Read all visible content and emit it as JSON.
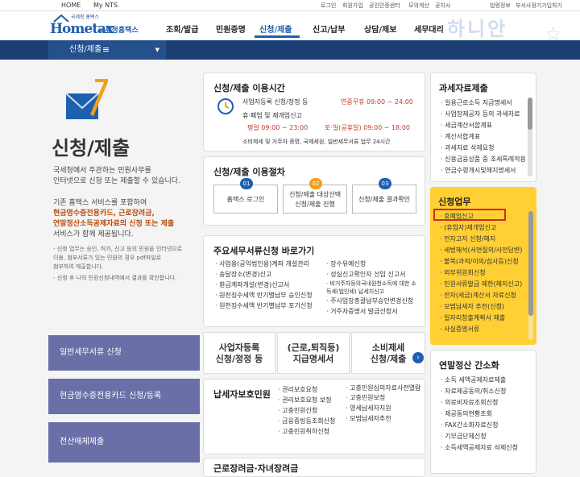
{
  "topbar": {
    "tabs": [
      "HOME",
      "My NTS"
    ],
    "links": [
      "로그인",
      "회원가입",
      "공인인증센터",
      "모의계산",
      "공지사항",
      "법령정보",
      "부서사정기가입하기"
    ]
  },
  "header": {
    "logo_small": "국세청 홈택스",
    "logo_name": "Hometax",
    "logo_kor": "국세청홈택스",
    "menu": [
      "조회/발급",
      "민원증명",
      "신청/제출",
      "신고/납부",
      "상담/제보",
      "세무대리"
    ],
    "watermark": "하니안",
    "watermark_star": "☆"
  },
  "navbar": {
    "selected": "신청/제출"
  },
  "left": {
    "title": "신청/제출",
    "desc1": [
      "국세청에서 주관하는 민원사무를",
      "인터넷으로 신청 또는 제출할 수 있습니다."
    ],
    "desc2_pre": "기존 홈택스 서비스를 포함하여",
    "desc2_hl1": "현금영수증전용카드, 근로장려금,",
    "desc2_hl2": "연말정산소득공제자료의 신청 또는 제출",
    "desc2_post": "서비스가 함께 제공됩니다.",
    "note1": [
      "- 신청 업무는 승인, 허가, 신고 등의 민원을 인터넷으로",
      "  이용, 첨부서류가 있는 민원의 경우 pdf파일로",
      "  첨부하여 제출합니다."
    ],
    "note2": "- 신청 후 나의 민원신청내역에서 결과를 확인합니다.",
    "buttons": [
      "일반세무서류 신청",
      "현금영수증전용카드 신청/등록",
      "전산매체제출"
    ]
  },
  "hours": {
    "title": "신청/제출 이용시간",
    "row1_label": "사업자등록 신청/정정 등",
    "row1_value": "연중무휴 09:00 ~ 24:00",
    "row2_label": "휴·폐업 및 재개업신고",
    "row3a_label": "평일 09:00 ~ 23:00",
    "row3b_label": "토·일(공휴일) 09:00 ~ 18:00",
    "row4_label": "소비제세 및 거주자 증명, 국제세원, 일반세무서류 업무 24시간"
  },
  "procedure": {
    "title": "신청/제출 이용절차",
    "steps": [
      {
        "num": "01",
        "label": "홈택스 로그인"
      },
      {
        "num": "02",
        "label": "신청/제출 대상선택\n신청/제출 진행"
      },
      {
        "num": "03",
        "label": "신청/제출 결과확인"
      }
    ]
  },
  "shortcuts": {
    "title": "주요세무서류신청 바로가기",
    "col1": [
      "사업용(공익법인용)계좌 개설관리",
      "송달장소(변경)신고",
      "환급계좌개설(변경)신고서",
      "원천징수세액 반기별납부 승인신청",
      "원천징수세액 반기별납부 포기신청"
    ],
    "col2": [
      "장수유예신청",
      "성실신고확인자 선임 신고서",
      "비거주자등의국내원천소득에 대한 소득세(법인세) 납세지신고",
      "주사업장총괄납부승인변경신청",
      "거주자증명서 발급신청서"
    ]
  },
  "quick": [
    {
      "label": "사업자등록\n신청/정정 등"
    },
    {
      "label": "(근로,퇴직등)\n지급명세서"
    },
    {
      "label": "소비제세\n신청/제출"
    }
  ],
  "quick_arrow": "›",
  "taxpayer": {
    "title": "납세자보호민원",
    "col1": [
      "권리보호요청",
      "권리보호요청 보정",
      "고충민원신청",
      "금융증빙등조회신청",
      "고충민원취하신청"
    ],
    "col2": [
      "고충민원심의자료사전열람",
      "고충민원보정",
      "영세납세자지원",
      "모범납세자추천"
    ]
  },
  "earned": {
    "title": "근로장려금·자녀장려금"
  },
  "r1": {
    "title": "과세자료제출",
    "items": [
      "일용근로소득 지급명세서",
      "사업장제공자 등의 과세자료",
      "세금계산서합계표",
      "계산서합계표",
      "과세자료 삭제요청",
      "신용금융상품 중 조세특례적용",
      "연금수령개시및해지명세서"
    ]
  },
  "r2": {
    "title": "신청업무",
    "items": [
      "휴폐업신고",
      "(휴업자)재개업신고",
      "전자고지 신청/해지",
      "세법해석(서면질의/사전답변)",
      "불복(과적/이의/심사등)신청",
      "외부위원회신청",
      "민원서류발급 제한(해지신고)",
      "전자(세금)계산서 자료신청",
      "모범납세자 추천(신청)",
      "일자리창출계획서 제출",
      "사실증명서류"
    ]
  },
  "r3": {
    "title": "연말정산 간소화",
    "items": [
      "소득 세액공제자료제출",
      "자료제공동의/취소신청",
      "의료비자료조회신청",
      "제공동의현황조회",
      "FAX간소화자료신청",
      "기부금단체신청",
      "소득세액공제자료 삭제신청"
    ]
  },
  "colors": {
    "navy": "#1b3f72",
    "blue": "#1f5fb0",
    "orange": "#f1a01b",
    "yellow": "#ffcf33",
    "purple": "#6b6fa8"
  }
}
